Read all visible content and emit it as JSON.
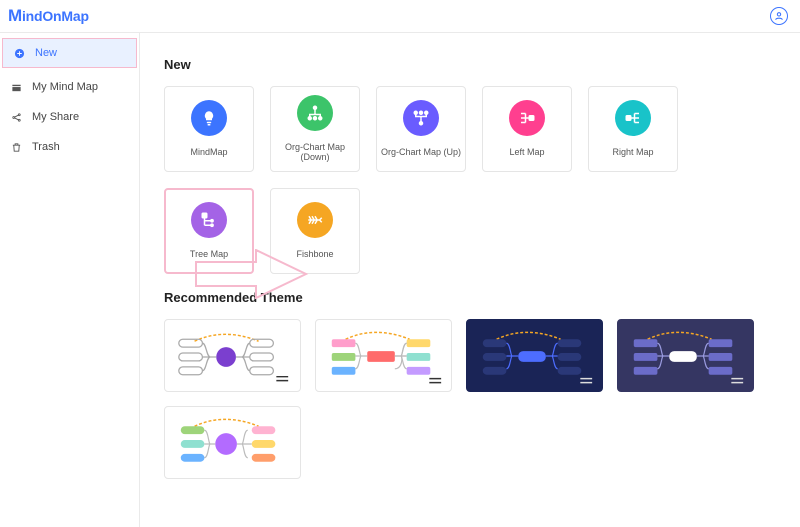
{
  "app": {
    "logo_text": "indOnMap"
  },
  "sidebar": {
    "items": [
      {
        "label": "New"
      },
      {
        "label": "My Mind Map"
      },
      {
        "label": "My Share"
      },
      {
        "label": "Trash"
      }
    ]
  },
  "main": {
    "new_title": "New",
    "templates": [
      {
        "label": "MindMap",
        "color": "#3c74ff",
        "icon": "bulb"
      },
      {
        "label": "Org-Chart Map (Down)",
        "color": "#3cc46a",
        "icon": "org-down"
      },
      {
        "label": "Org-Chart Map (Up)",
        "color": "#6a5cff",
        "icon": "org-up"
      },
      {
        "label": "Left Map",
        "color": "#ff3f8f",
        "icon": "left-map"
      },
      {
        "label": "Right Map",
        "color": "#19c3c9",
        "icon": "right-map"
      },
      {
        "label": "Tree Map",
        "color": "#a463e6",
        "icon": "tree"
      },
      {
        "label": "Fishbone",
        "color": "#f5a623",
        "icon": "fishbone"
      }
    ],
    "recommended_title": "Recommended Theme"
  }
}
